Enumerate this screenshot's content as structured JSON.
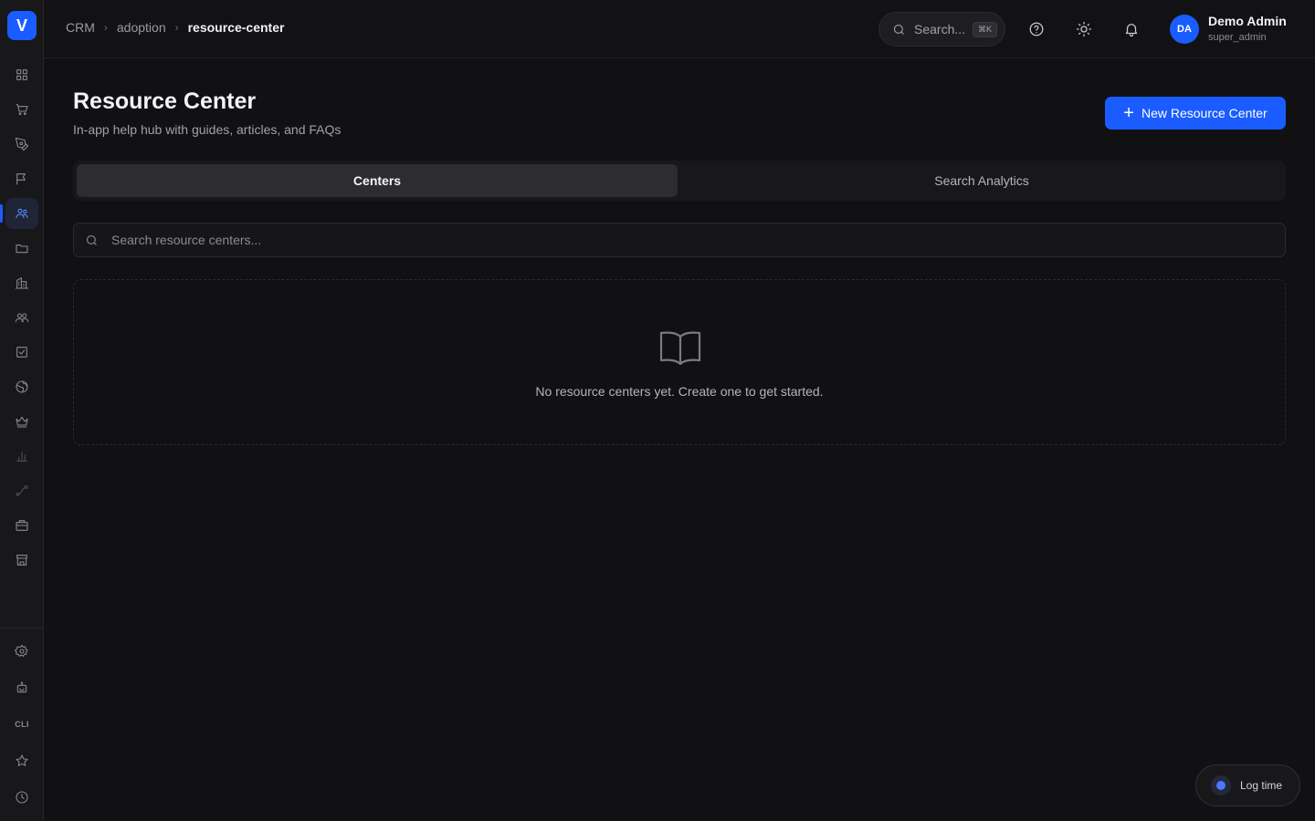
{
  "app": {
    "logo_letter": "V"
  },
  "breadcrumb": {
    "items": [
      "CRM",
      "adoption"
    ],
    "current": "resource-center",
    "separator": "›"
  },
  "topbar": {
    "search_label": "Search...",
    "search_shortcut": "⌘K",
    "user": {
      "initials": "DA",
      "name": "Demo Admin",
      "role": "super_admin"
    }
  },
  "sidebar": {
    "items": [
      {
        "icon": "grid-icon"
      },
      {
        "icon": "cart-icon"
      },
      {
        "icon": "pen-tool-icon"
      },
      {
        "icon": "flag-icon"
      },
      {
        "icon": "users-group-icon",
        "active": true
      },
      {
        "icon": "folder-icon"
      },
      {
        "icon": "building-icon"
      },
      {
        "icon": "contacts-icon"
      },
      {
        "icon": "check-square-icon"
      },
      {
        "icon": "globe-icon"
      },
      {
        "icon": "crown-icon"
      },
      {
        "icon": "bar-chart-icon"
      },
      {
        "icon": "route-icon"
      },
      {
        "icon": "briefcase-icon"
      },
      {
        "icon": "store-icon"
      }
    ],
    "bottom": {
      "cli_label": "CLI"
    }
  },
  "page": {
    "title": "Resource Center",
    "subtitle": "In-app help hub with guides, articles, and FAQs",
    "new_button_label": "New Resource Center"
  },
  "tabs": [
    {
      "label": "Centers",
      "active": true
    },
    {
      "label": "Search Analytics",
      "active": false
    }
  ],
  "search": {
    "placeholder": "Search resource centers...",
    "value": ""
  },
  "empty_state": {
    "icon": "book-open-icon",
    "text": "No resource centers yet. Create one to get started."
  },
  "log_time": {
    "label": "Log time"
  },
  "colors": {
    "accent": "#1a5cff",
    "background": "#111114",
    "sidebar": "#18181b"
  }
}
